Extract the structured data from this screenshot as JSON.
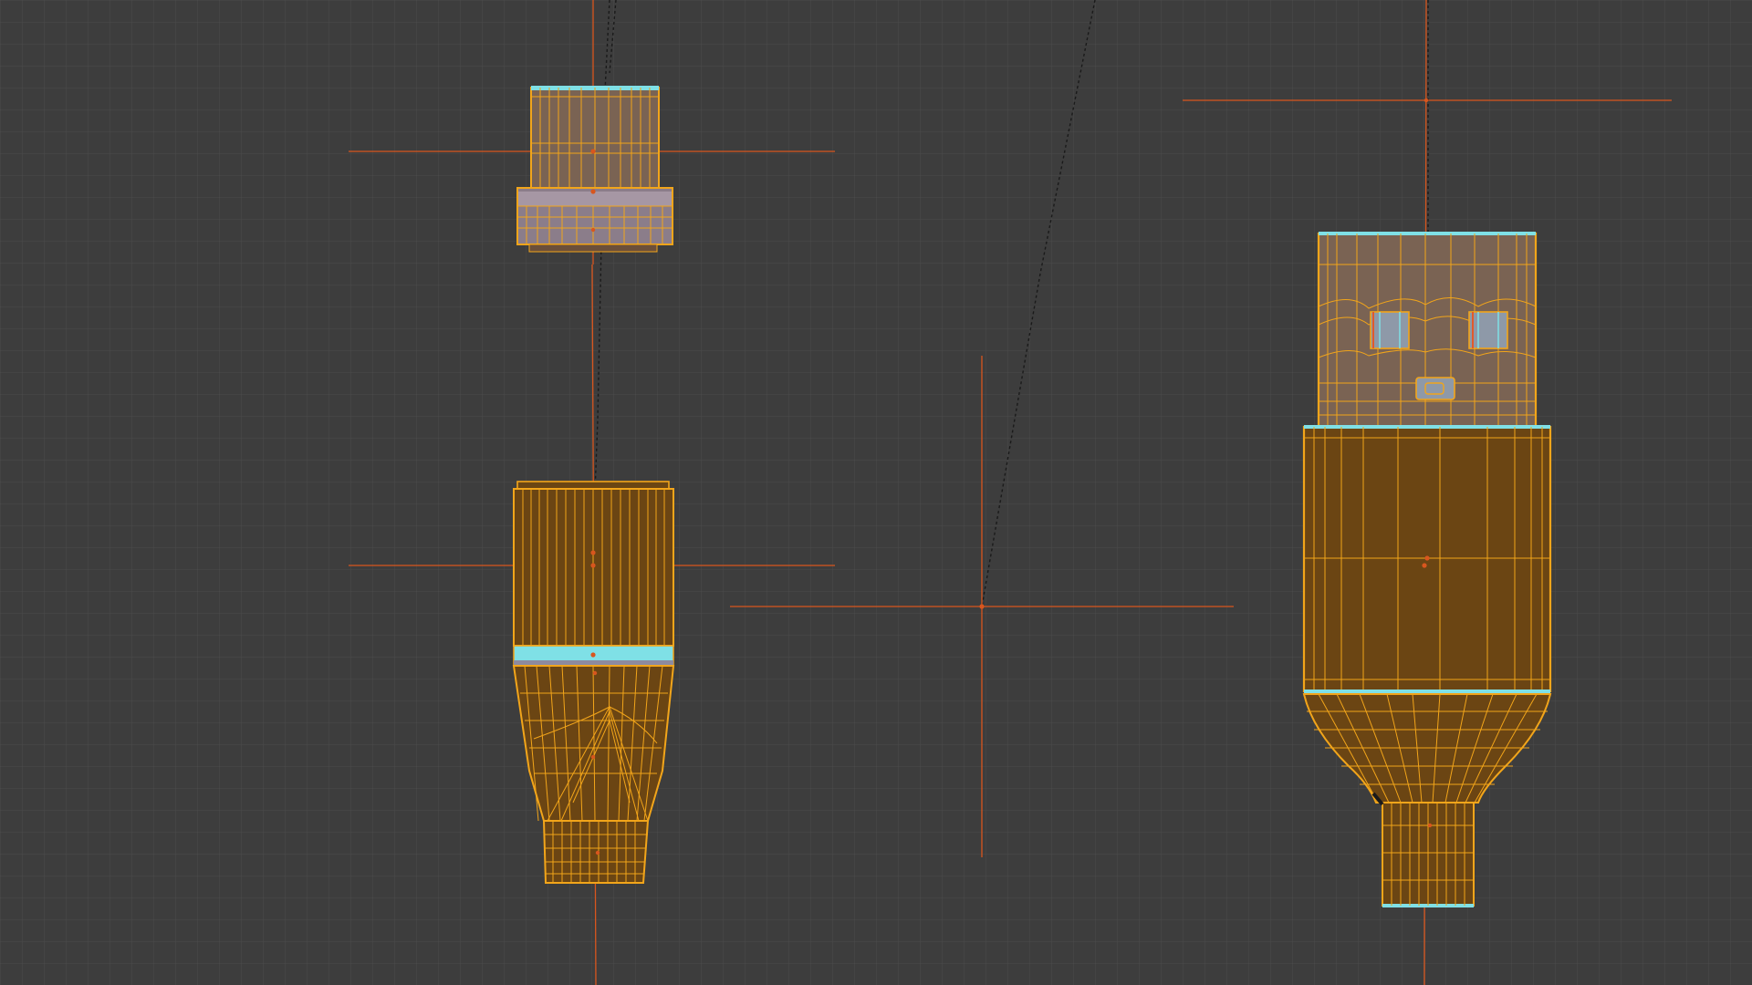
{
  "viewport": {
    "mode": "wireframe",
    "view": "orthographic",
    "grid": true,
    "selection_state": "all-selected",
    "objects": [
      {
        "id": "connector-cap",
        "type": "mesh",
        "selected": true
      },
      {
        "id": "connector-body",
        "type": "mesh",
        "selected": true
      },
      {
        "id": "usb-plug",
        "type": "mesh",
        "selected": true
      },
      {
        "id": "empty-object",
        "type": "empty",
        "selected": true
      }
    ],
    "colors": {
      "background": "#3d3d3d",
      "grid_line": "#4a4a4a",
      "wire_selected": "#f2a51a",
      "face_fill": "#6b4513",
      "face_fill_light": "#8a6a52",
      "highlight_edge": "#7fe0e6",
      "origin_axis": "#d8561e",
      "relationship_line": "#111111"
    }
  }
}
